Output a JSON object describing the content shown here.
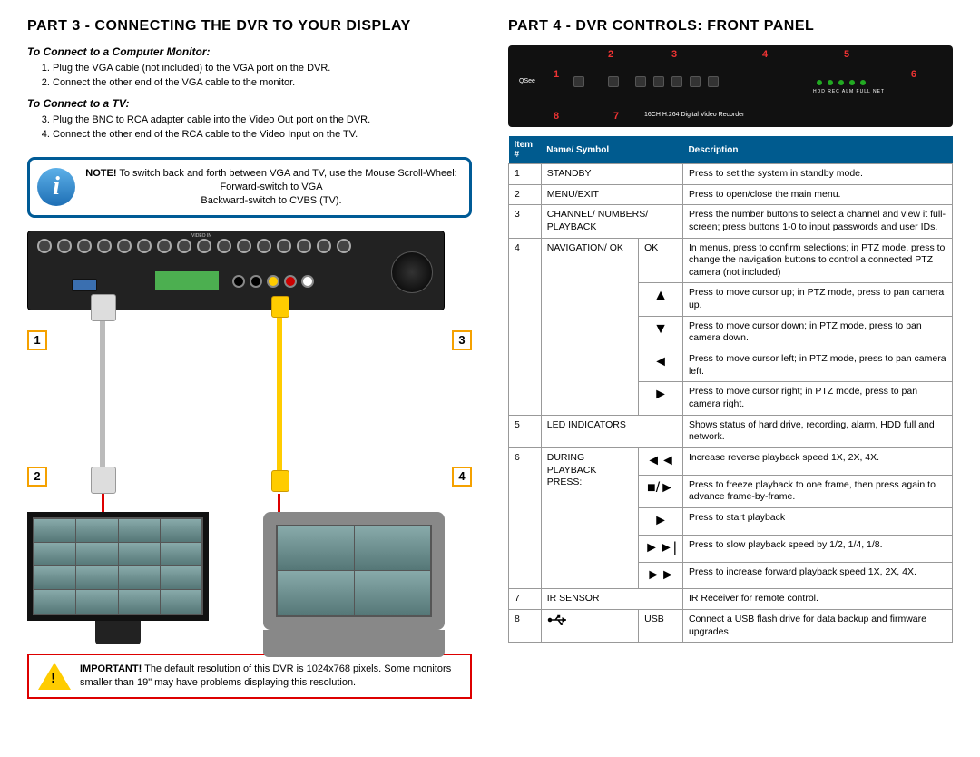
{
  "left": {
    "title": "PART 3 - CONNECTING THE DVR TO YOUR DISPLAY",
    "sub_monitor": "To Connect to a Computer Monitor:",
    "steps_monitor": [
      "Plug the VGA cable (not included) to the VGA port on the DVR.",
      "Connect the other end of the VGA cable to the monitor."
    ],
    "sub_tv": "To Connect to a TV:",
    "steps_tv": [
      "Plug the BNC to RCA adapter cable into the Video Out port on the DVR.",
      "Connect the other end of the RCA cable to the Video Input on the TV."
    ],
    "note_label": "NOTE!",
    "note_body": "To switch back and forth between VGA and TV, use the Mouse Scroll-Wheel: Forward-switch to VGA",
    "note_body2": "Backward-switch to CVBS (TV).",
    "badges": {
      "n1": "1",
      "n2": "2",
      "n3": "3",
      "n4": "4"
    },
    "important_label": "IMPORTANT!",
    "important_body": "The default resolution of this DVR is 1024x768 pixels. Some monitors smaller than 19\" may have problems displaying this resolution."
  },
  "right": {
    "title": "PART 4 - DVR CONTROLS: FRONT PANEL",
    "front_text": "16CH H.264 Digital Video Recorder",
    "brand": "QSee",
    "th_item": "Item #",
    "th_name": "Name/ Symbol",
    "th_desc": "Description",
    "rows": [
      {
        "num": "1",
        "name": "STANDBY",
        "desc": "Press to set the system in standby mode."
      },
      {
        "num": "2",
        "name": "MENU/EXIT",
        "desc": "Press to open/close the main menu."
      },
      {
        "num": "3",
        "name": "CHANNEL/ NUMBERS/ PLAYBACK",
        "desc": "Press the number buttons to select a channel and view it full-screen; press buttons 1-0 to input passwords and user IDs."
      }
    ],
    "row4": {
      "num": "4",
      "name": "NAVIGATION/ OK",
      "sub": [
        {
          "sym": "OK",
          "desc": "In menus, press to confirm selections; in PTZ mode, press to change the navigation buttons to control a connected PTZ camera (not included)"
        },
        {
          "sym": "▲",
          "desc": "Press to move cursor up; in PTZ mode, press to pan camera up."
        },
        {
          "sym": "▼",
          "desc": "Press to move cursor down; in PTZ mode, press to pan camera down."
        },
        {
          "sym": "◄",
          "desc": "Press to move cursor left; in PTZ mode, press to pan camera left."
        },
        {
          "sym": "►",
          "desc": "Press to move cursor right; in PTZ mode, press to pan camera right."
        }
      ]
    },
    "row5": {
      "num": "5",
      "name": "LED INDICATORS",
      "desc": "Shows status of hard drive, recording, alarm, HDD full and network."
    },
    "row6": {
      "num": "6",
      "name": "DURING PLAYBACK PRESS:",
      "sub": [
        {
          "sym": "◄◄",
          "desc": "Increase reverse playback speed 1X, 2X, 4X."
        },
        {
          "sym": "■/►",
          "desc": "Press to freeze playback to one frame, then press again to advance frame-by-frame."
        },
        {
          "sym": "►",
          "desc": "Press to start playback"
        },
        {
          "sym": "►►|",
          "desc": "Press to slow playback speed by 1/2, 1/4, 1/8."
        },
        {
          "sym": "►►",
          "desc": "Press to increase forward playback speed 1X, 2X, 4X."
        }
      ]
    },
    "row7": {
      "num": "7",
      "name": "IR SENSOR",
      "desc": "IR Receiver for remote control."
    },
    "row8": {
      "num": "8",
      "name": "USB",
      "desc": "Connect a USB flash drive for data backup and firmware upgrades"
    }
  }
}
